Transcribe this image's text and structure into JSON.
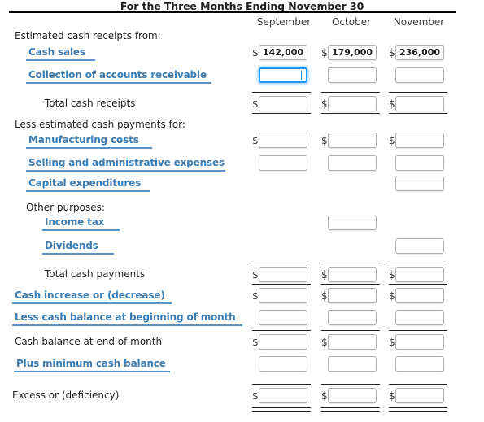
{
  "header": {
    "title": "For the Three Months Ending November 30",
    "columns": [
      "September",
      "October",
      "November"
    ]
  },
  "colors": {
    "link": "#3e7cb1",
    "underline": "#5b92c4",
    "focus": "#2196f3",
    "rule": "#231f20",
    "box_border": "#adb0b3"
  },
  "rows": [
    {
      "key": "estimated_cash_receipts_from",
      "label": "Estimated cash receipts from:",
      "style": "plain",
      "indent": 18,
      "cells": []
    },
    {
      "key": "cash_sales",
      "label": "Cash sales",
      "style": "linked",
      "indent": 35,
      "underline_width": 85,
      "cells": [
        {
          "col": "september",
          "dollar": "$",
          "value": "142,000",
          "focused": false
        },
        {
          "col": "october",
          "dollar": "$",
          "value": "179,000",
          "focused": false
        },
        {
          "col": "november",
          "dollar": "$",
          "value": "236,000",
          "focused": false
        }
      ]
    },
    {
      "key": "collection_of_accounts_receivable",
      "label": "Collection of accounts receivable",
      "style": "linked",
      "indent": 35,
      "underline_width": 228,
      "cells": [
        {
          "col": "september",
          "dollar": "",
          "value": "",
          "focused": true
        },
        {
          "col": "october",
          "dollar": "",
          "value": "",
          "focused": false
        },
        {
          "col": "november",
          "dollar": "",
          "value": "",
          "focused": false
        }
      ]
    },
    {
      "key": "total_cash_receipts",
      "label": "Total cash receipts",
      "style": "plain",
      "indent": 55,
      "rule_above": "single",
      "cells": [
        {
          "col": "september",
          "dollar": "$",
          "value": "",
          "focused": false
        },
        {
          "col": "october",
          "dollar": "$",
          "value": "",
          "focused": false
        },
        {
          "col": "november",
          "dollar": "$",
          "value": "",
          "focused": false
        }
      ]
    },
    {
      "key": "less_estimated_cash_payments_for",
      "label": "Less estimated cash payments for:",
      "style": "plain",
      "indent": 18,
      "rule_above": "single",
      "cells": []
    },
    {
      "key": "manufacturing_costs",
      "label": "Manufacturing costs",
      "style": "linked",
      "indent": 35,
      "underline_width": 155,
      "cells": [
        {
          "col": "september",
          "dollar": "$",
          "value": "",
          "focused": false
        },
        {
          "col": "october",
          "dollar": "$",
          "value": "",
          "focused": false
        },
        {
          "col": "november",
          "dollar": "$",
          "value": "",
          "focused": false
        }
      ]
    },
    {
      "key": "selling_and_administrative_expenses",
      "label": "Selling and administrative expenses",
      "style": "linked",
      "indent": 35,
      "underline_width": 245,
      "cells": [
        {
          "col": "september",
          "dollar": "",
          "value": "",
          "focused": false
        },
        {
          "col": "october",
          "dollar": "",
          "value": "",
          "focused": false
        },
        {
          "col": "november",
          "dollar": "",
          "value": "",
          "focused": false
        }
      ]
    },
    {
      "key": "capital_expenditures",
      "label": "Capital expenditures",
      "style": "linked",
      "indent": 35,
      "underline_width": 152,
      "cells": [
        {
          "col": "november",
          "dollar": "",
          "value": "",
          "focused": false
        }
      ]
    },
    {
      "key": "other_purposes",
      "label": "Other purposes:",
      "style": "plain",
      "indent": 32,
      "cells": []
    },
    {
      "key": "income_tax",
      "label": "Income tax",
      "style": "linked",
      "indent": 55,
      "underline_width": 95,
      "cells": [
        {
          "col": "october",
          "dollar": "",
          "value": "",
          "focused": false
        }
      ]
    },
    {
      "key": "dividends",
      "label": "Dividends",
      "style": "linked",
      "indent": 55,
      "underline_width": 88,
      "cells": [
        {
          "col": "november",
          "dollar": "",
          "value": "",
          "focused": false
        }
      ]
    },
    {
      "key": "total_cash_payments",
      "label": "Total cash payments",
      "style": "plain",
      "indent": 55,
      "rule_above": "single",
      "cells": [
        {
          "col": "september",
          "dollar": "$",
          "value": "",
          "focused": false
        },
        {
          "col": "october",
          "dollar": "$",
          "value": "",
          "focused": false
        },
        {
          "col": "november",
          "dollar": "$",
          "value": "",
          "focused": false
        }
      ]
    },
    {
      "key": "cash_increase_or_decrease",
      "label": "Cash increase or (decrease)",
      "style": "linked",
      "indent": 18,
      "underline_width": 196,
      "rule_above": "single",
      "cells": [
        {
          "col": "september",
          "dollar": "$",
          "value": "",
          "focused": false
        },
        {
          "col": "october",
          "dollar": "$",
          "value": "",
          "focused": false
        },
        {
          "col": "november",
          "dollar": "$",
          "value": "",
          "focused": false
        }
      ]
    },
    {
      "key": "less_cash_balance_at_beginning_of_month",
      "label": "Less cash balance at beginning of month",
      "style": "linked",
      "indent": 18,
      "underline_width": 283,
      "cells": [
        {
          "col": "september",
          "dollar": "",
          "value": "",
          "focused": false
        },
        {
          "col": "october",
          "dollar": "",
          "value": "",
          "focused": false
        },
        {
          "col": "november",
          "dollar": "",
          "value": "",
          "focused": false
        }
      ]
    },
    {
      "key": "cash_balance_at_end_of_month",
      "label": "Cash balance at end of month",
      "style": "plain",
      "indent": 18,
      "rule_above": "single",
      "cells": [
        {
          "col": "september",
          "dollar": "$",
          "value": "",
          "focused": false
        },
        {
          "col": "october",
          "dollar": "$",
          "value": "",
          "focused": false
        },
        {
          "col": "november",
          "dollar": "$",
          "value": "",
          "focused": false
        }
      ]
    },
    {
      "key": "plus_minimum_cash_balance",
      "label": "Plus minimum cash balance",
      "style": "linked",
      "indent": 20,
      "underline_width": 192,
      "cells": [
        {
          "col": "september",
          "dollar": "",
          "value": "",
          "focused": false
        },
        {
          "col": "october",
          "dollar": "",
          "value": "",
          "focused": false
        },
        {
          "col": "november",
          "dollar": "",
          "value": "",
          "focused": false
        }
      ]
    },
    {
      "key": "excess_or_deficiency",
      "label": "Excess or (deficiency)",
      "style": "plain",
      "indent": 15,
      "rule_above": "single",
      "rule_below": "double",
      "cells": [
        {
          "col": "september",
          "dollar": "$",
          "value": "",
          "focused": false
        },
        {
          "col": "october",
          "dollar": "$",
          "value": "",
          "focused": false
        },
        {
          "col": "november",
          "dollar": "$",
          "value": "",
          "focused": false
        }
      ]
    }
  ]
}
